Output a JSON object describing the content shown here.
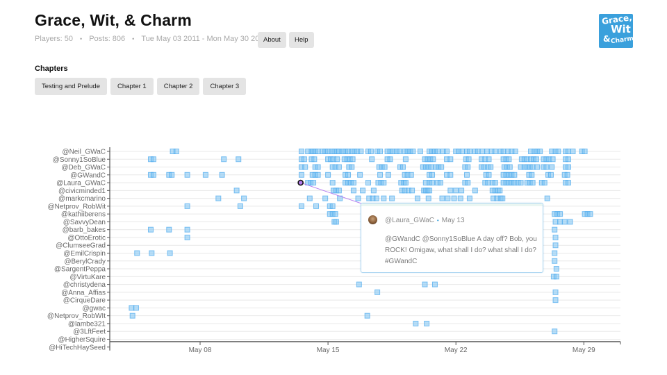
{
  "header": {
    "title": "Grace, Wit, & Charm",
    "players": "Players: 50",
    "posts": "Posts: 806",
    "date_range": "Tue May 03 2011 - Mon May 30 2011",
    "separator": "•",
    "about_label": "About",
    "help_label": "Help",
    "logo_lines": [
      "Grace,",
      "Wit",
      "&",
      "Charm"
    ]
  },
  "chapters": {
    "label": "Chapters",
    "items": [
      "Testing and Prelude",
      "Chapter 1",
      "Chapter 2",
      "Chapter 3"
    ]
  },
  "colors": {
    "accent": "#3aa0dc",
    "dot_fill": "#7cc2f3",
    "dot_stroke": "#4aa8ec",
    "highlight": "#b57cf0",
    "gridline": "#e8e8e8"
  },
  "tooltip": {
    "user": "@Laura_GWaC",
    "date": "May 13",
    "text": "@GWandC @Sonny1SoBlue A day off? Bob, you ROCK! Omigaw, what shall I do? what shall I do? #GWandC"
  },
  "chart_data": {
    "type": "scatter",
    "title": "",
    "xlabel": "",
    "ylabel": "",
    "x_unit": "days since May 03 2011",
    "x_range": [
      0,
      28
    ],
    "x_ticks": [
      {
        "label": "May 08",
        "value": 5
      },
      {
        "label": "May 15",
        "value": 12
      },
      {
        "label": "May 22",
        "value": 19
      },
      {
        "label": "May 29",
        "value": 26
      }
    ],
    "grid": true,
    "players": [
      "@Neil_GWaC",
      "@Sonny1SoBlue",
      "@Deb_GWaC",
      "@GWandC",
      "@Laura_GWaC",
      "@civicminded1",
      "@markcmarino",
      "@Netprov_RobWit",
      "@kathiiberens",
      "@SavvyDean",
      "@barb_bakes",
      "@OttoErotic",
      "@ClumseeGrad",
      "@EmilCrispin",
      "@BerylCrady",
      "@SargentPeppa",
      "@VirtuKare",
      "@christydena",
      "@Anna_Affias",
      "@CirqueDare",
      "@gwac",
      "@Netprov_RobWIt",
      "@lambe321",
      "@3LftFeet",
      "@HigherSquire",
      "@HiTechHaySeed"
    ],
    "highlighted": {
      "player": "@Laura_GWaC",
      "day": 10.5
    },
    "series": [
      {
        "name": "@Neil_GWaC",
        "days": [
          3.5,
          3.7,
          10.55,
          10.9,
          11.1,
          11.2,
          11.3,
          11.45,
          11.7,
          11.85,
          12.0,
          12.2,
          12.35,
          12.5,
          12.6,
          12.8,
          12.95,
          13.1,
          13.3,
          13.45,
          13.6,
          13.8,
          14.2,
          14.35,
          14.7,
          14.85,
          15.25,
          15.4,
          15.55,
          15.75,
          15.9,
          16.2,
          16.35,
          16.5,
          16.65,
          17.05,
          17.55,
          17.7,
          17.85,
          18.0,
          18.3,
          18.5,
          19.0,
          19.15,
          19.35,
          19.6,
          19.75,
          20.05,
          20.2,
          20.45,
          20.7,
          20.95,
          21.15,
          21.45,
          21.6,
          21.85,
          22.05,
          22.25,
          23.1,
          23.3,
          23.45,
          23.6,
          24.25,
          24.45,
          24.6,
          25.0,
          25.15,
          25.4,
          25.9,
          26.05
        ]
      },
      {
        "name": "@Sonny1SoBlue",
        "days": [
          2.3,
          2.45,
          6.3,
          7.1,
          10.55,
          10.7,
          11.1,
          11.25,
          12.0,
          12.15,
          12.3,
          12.5,
          12.9,
          13.05,
          13.2,
          13.35,
          14.4,
          15.25,
          15.4,
          16.25,
          17.3,
          17.45,
          17.6,
          17.75,
          18.5,
          18.7,
          19.55,
          19.7,
          20.4,
          20.6,
          20.8,
          21.6,
          21.75,
          21.9,
          22.6,
          22.75,
          22.9,
          23.1,
          23.25,
          23.4,
          23.8,
          23.95,
          24.1,
          24.3,
          25.0,
          25.15
        ]
      },
      {
        "name": "@Deb_GWaC",
        "days": [
          10.55,
          10.75,
          11.3,
          11.45,
          12.25,
          12.4,
          12.6,
          13.15,
          13.3,
          14.8,
          14.95,
          15.1,
          15.95,
          16.1,
          17.2,
          17.35,
          17.5,
          17.65,
          17.9,
          18.05,
          18.2,
          19.5,
          19.65,
          20.4,
          20.55,
          20.75,
          20.9,
          21.65,
          21.8,
          21.95,
          22.55,
          22.75,
          22.9,
          23.05,
          23.2,
          23.45,
          23.8,
          23.95,
          24.25,
          25.0,
          25.15
        ]
      },
      {
        "name": "@GWandC",
        "days": [
          2.3,
          2.45,
          3.3,
          3.45,
          4.3,
          5.3,
          6.2,
          10.55,
          11.15,
          11.3,
          11.45,
          12.0,
          12.95,
          13.1,
          13.75,
          14.85,
          15.3,
          16.2,
          16.35,
          16.55,
          17.55,
          17.7,
          18.5,
          18.7,
          19.6,
          20.65,
          20.8,
          21.6,
          21.75,
          21.9,
          22.05,
          22.2,
          23.0,
          23.15,
          24.05,
          24.2,
          24.95,
          25.1
        ]
      },
      {
        "name": "@Laura_GWaC",
        "days": [
          10.9,
          11.05,
          11.2,
          12.25,
          12.95,
          13.1,
          13.25,
          13.4,
          14.2,
          14.75,
          14.9,
          15.05,
          16.0,
          16.15,
          16.25,
          17.35,
          17.55,
          17.7,
          18.0,
          18.15,
          19.5,
          19.65,
          20.6,
          20.75,
          21.0,
          21.15,
          21.6,
          21.75,
          21.9,
          22.05,
          22.2,
          22.4,
          22.55,
          22.9,
          23.05,
          23.2,
          23.7,
          23.85,
          25.0,
          25.15
        ]
      },
      {
        "name": "@civicminded1",
        "days": [
          7.0,
          12.3,
          12.45,
          12.6,
          13.4,
          13.9,
          14.5,
          16.05,
          16.2,
          16.4,
          16.6,
          17.25,
          17.35,
          17.45,
          17.55,
          18.7,
          19.0,
          19.3,
          20.05,
          21.0,
          21.15,
          21.3,
          21.4
        ]
      },
      {
        "name": "@markcmarino",
        "days": [
          6.0,
          7.4,
          11.0,
          11.85,
          12.65,
          13.65,
          14.25,
          14.45,
          14.65,
          15.05,
          15.5,
          16.9,
          17.5,
          18.25,
          18.55,
          18.9,
          19.25,
          19.75,
          21.05,
          21.25,
          21.45,
          21.55,
          24.0
        ]
      },
      {
        "name": "@Netprov_RobWit",
        "days": [
          4.3,
          7.2,
          10.55,
          11.35,
          12.1,
          12.25,
          17.0,
          17.85,
          18.1,
          18.25,
          18.85,
          19.4,
          20.5,
          21.3
        ]
      },
      {
        "name": "@kathiiberens",
        "days": [
          12.1,
          12.25,
          12.4,
          17.55,
          18.3,
          18.45,
          24.4,
          24.55,
          24.7,
          26.05,
          26.2,
          26.35
        ]
      },
      {
        "name": "@SavvyDean",
        "days": [
          12.35,
          12.45,
          17.55,
          24.45,
          24.7,
          24.95,
          25.25
        ]
      },
      {
        "name": "@barb_bakes",
        "days": [
          2.3,
          3.3,
          4.3,
          17.55,
          24.4
        ]
      },
      {
        "name": "@OttoErotic",
        "days": [
          4.3,
          17.55,
          24.45
        ]
      },
      {
        "name": "@ClumseeGrad",
        "days": [
          24.45
        ]
      },
      {
        "name": "@EmilCrispin",
        "days": [
          1.55,
          2.35,
          3.35,
          17.55,
          24.4
        ]
      },
      {
        "name": "@BerylCrady",
        "days": [
          24.4
        ]
      },
      {
        "name": "@SargentPeppa",
        "days": [
          24.5
        ]
      },
      {
        "name": "@VirtuKare",
        "days": [
          24.35,
          24.5
        ]
      },
      {
        "name": "@christydena",
        "days": [
          13.7,
          17.3,
          17.85
        ]
      },
      {
        "name": "@Anna_Affias",
        "days": [
          14.7,
          24.45
        ]
      },
      {
        "name": "@CirqueDare",
        "days": [
          24.45
        ]
      },
      {
        "name": "@gwac",
        "days": [
          1.25,
          1.5
        ]
      },
      {
        "name": "@Netprov_RobWIt",
        "days": [
          1.3,
          14.15
        ]
      },
      {
        "name": "@lambe321",
        "days": [
          16.8,
          17.4
        ]
      },
      {
        "name": "@3LftFeet",
        "days": [
          24.4
        ]
      },
      {
        "name": "@HigherSquire",
        "days": []
      },
      {
        "name": "@HiTechHaySeed",
        "days": []
      }
    ]
  }
}
